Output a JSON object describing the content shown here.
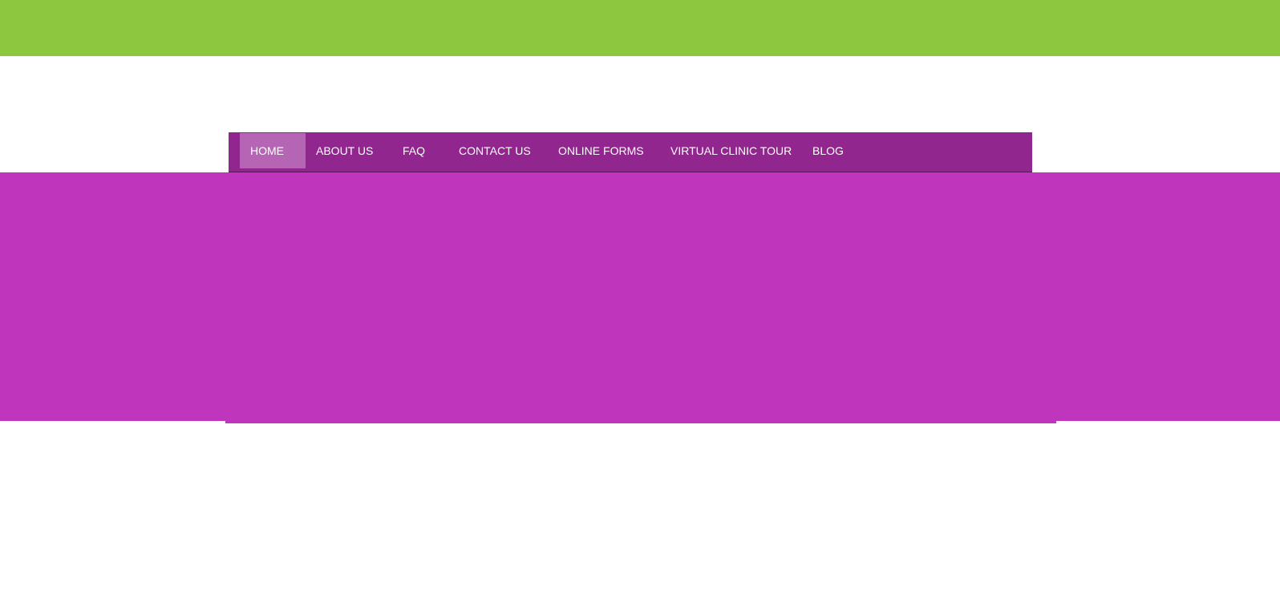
{
  "colors": {
    "top_bar": "#8dc63f",
    "nav_background": "#92268f",
    "nav_active": "#b565b3",
    "hero": "#bf36bc",
    "nav_text": "#ffffff"
  },
  "nav": {
    "items": [
      {
        "label": "HOME",
        "active": true
      },
      {
        "label": "ABOUT US",
        "active": false
      },
      {
        "label": "FAQ",
        "active": false
      },
      {
        "label": "CONTACT US",
        "active": false
      },
      {
        "label": "ONLINE FORMS",
        "active": false
      },
      {
        "label": "VIRTUAL CLINIC TOUR",
        "active": false
      },
      {
        "label": "BLOG",
        "active": false
      }
    ]
  }
}
